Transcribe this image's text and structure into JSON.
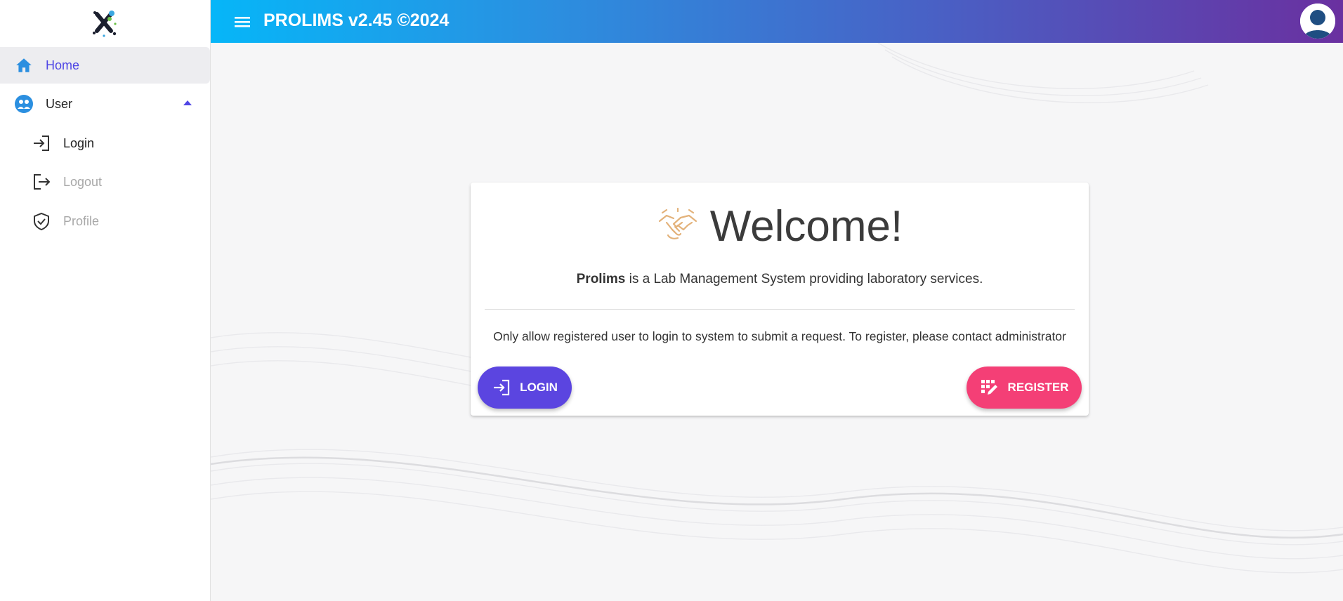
{
  "app": {
    "title": "PROLIMS v2.45 ©2024"
  },
  "colors": {
    "accent": "#4f46e5",
    "home_icon": "#2b8fe0",
    "login_button": "#5b45e0",
    "register_button": "#f43f76",
    "topbar_gradient": [
      "#06b6f8",
      "#6a30a0"
    ]
  },
  "sidebar": {
    "items": [
      {
        "label": "Home",
        "icon": "home-icon",
        "active": true
      },
      {
        "label": "User",
        "icon": "user-group-icon",
        "expanded": true
      },
      {
        "label": "Login",
        "icon": "login-icon",
        "enabled": true
      },
      {
        "label": "Logout",
        "icon": "logout-icon",
        "enabled": false
      },
      {
        "label": "Profile",
        "icon": "shield-check-icon",
        "enabled": false
      }
    ]
  },
  "card": {
    "welcome": "Welcome!",
    "desc_brand": "Prolims",
    "desc_rest": " is a Lab Management System providing laboratory services.",
    "note": "Only allow registered user to login to system to submit a request. To register, please contact administrator",
    "login_label": "LOGIN",
    "register_label": "REGISTER"
  }
}
